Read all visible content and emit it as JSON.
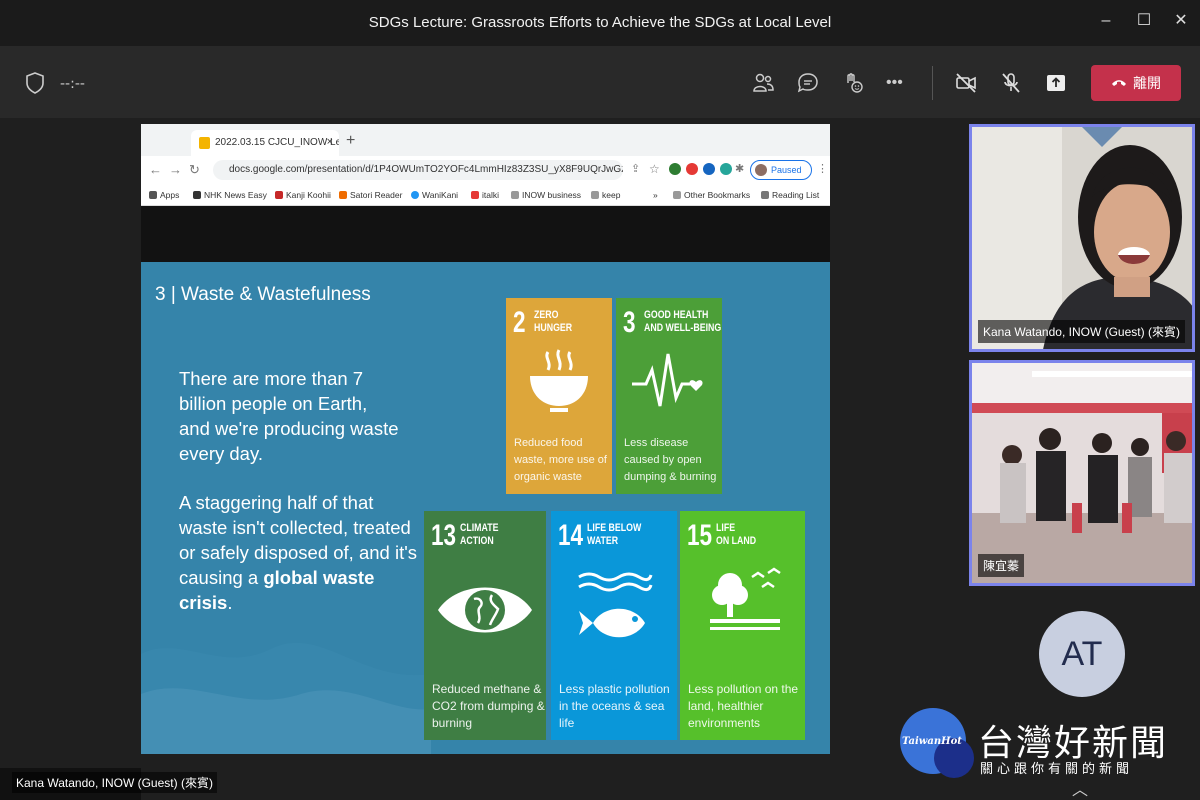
{
  "window": {
    "title": "SDGs Lecture: Grassroots Efforts to Achieve the SDGs at Local Level",
    "minimize": "–",
    "maximize": "☐",
    "close": "✕"
  },
  "toolbar": {
    "timer": "--:--",
    "more": "•••",
    "leave_label": "離開",
    "leave_color": "#c4314b"
  },
  "browser": {
    "tab_title": "2022.03.15 CJCU_INOW Lectu",
    "tab_close": "×",
    "new_tab": "+",
    "url": "docs.google.com/presentation/d/1P4OWUmTO2YOFc4LmmHIz83Z3SU_yX8F9UQrJwG2S...",
    "profile_status": "Paused",
    "bookmarks": [
      "Apps",
      "NHK News Easy",
      "Kanji Koohii",
      "Satori Reader",
      "WaniKani",
      "italki",
      "INOW business",
      "keep"
    ],
    "bookmarks_more": "»",
    "bookmarks_right": [
      "Other Bookmarks",
      "Reading List"
    ]
  },
  "slide": {
    "title": "3 | Waste & Wastefulness",
    "para1": "There are more than 7 billion people on Earth, and we're producing waste every day.",
    "para2_start": "A staggering half of that waste isn't collected, treated or safely disposed of, and it's causing a ",
    "para2_bold": "global waste crisis",
    "para2_end": ".",
    "cards": [
      {
        "num": "2",
        "label1": "ZERO",
        "label2": "HUNGER",
        "desc": "Reduced food waste, more use of organic waste",
        "color": "#dda63a",
        "icon": "bowl-icon"
      },
      {
        "num": "3",
        "label1": "GOOD HEALTH",
        "label2": "AND WELL-BEING",
        "desc": "Less disease caused by open dumping & burning",
        "color": "#4c9f38",
        "icon": "heartbeat-icon"
      },
      {
        "num": "13",
        "label1": "CLIMATE",
        "label2": "ACTION",
        "desc": "Reduced methane & CO2 from dumping & burning",
        "color": "#3f7e44",
        "icon": "eye-globe-icon"
      },
      {
        "num": "14",
        "label1": "LIFE BELOW",
        "label2": "WATER",
        "desc": "Less plastic pollution in the oceans & sea life",
        "color": "#0a97d9",
        "icon": "fish-icon"
      },
      {
        "num": "15",
        "label1": "LIFE",
        "label2": "ON LAND",
        "desc": "Less pollution on the land, healthier environments",
        "color": "#56c02b",
        "icon": "tree-icon"
      }
    ]
  },
  "presenter_name": "Kana Watando, INOW (Guest) (來賓)",
  "participants": [
    {
      "name": "Kana Watando, INOW (Guest) (來賓)"
    },
    {
      "name": "陳宜蓁"
    }
  ],
  "avatar_initials": "AT",
  "watermark": {
    "logo_text": "TaiwanHot",
    "name": "台灣好新聞",
    "subtitle": "關心跟你有關的新聞"
  },
  "scroll_chevron": "︿"
}
